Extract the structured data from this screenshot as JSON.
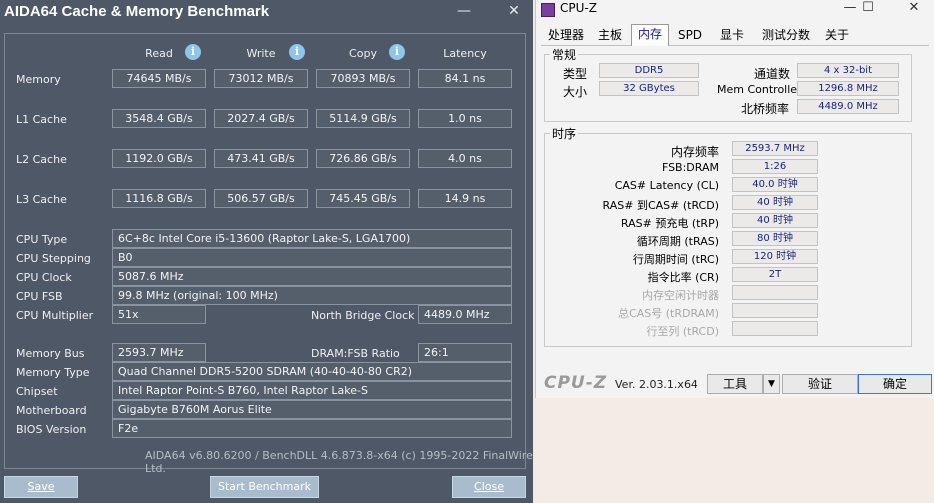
{
  "aida": {
    "title": "AIDA64 Cache & Memory Benchmark",
    "minimize_glyph": "—",
    "close_glyph": "✕",
    "info_glyph": "i",
    "columns": [
      "Read",
      "Write",
      "Copy",
      "Latency"
    ],
    "bench_rows": [
      {
        "label": "Memory",
        "values": [
          "74645 MB/s",
          "73012 MB/s",
          "70893 MB/s",
          "84.1 ns"
        ]
      },
      {
        "label": "L1 Cache",
        "values": [
          "3548.4 GB/s",
          "2027.4 GB/s",
          "5114.9 GB/s",
          "1.0 ns"
        ]
      },
      {
        "label": "L2 Cache",
        "values": [
          "1192.0 GB/s",
          "473.41 GB/s",
          "726.86 GB/s",
          "4.0 ns"
        ]
      },
      {
        "label": "L3 Cache",
        "values": [
          "1116.8 GB/s",
          "506.57 GB/s",
          "745.45 GB/s",
          "14.9 ns"
        ]
      }
    ],
    "cpu_type_label": "CPU Type",
    "cpu_type": "6C+8c Intel Core i5-13600  (Raptor Lake-S, LGA1700)",
    "cpu_stepping_label": "CPU Stepping",
    "cpu_stepping": "B0",
    "cpu_clock_label": "CPU Clock",
    "cpu_clock": "5087.6 MHz",
    "cpu_fsb_label": "CPU FSB",
    "cpu_fsb": "99.8 MHz  (original: 100 MHz)",
    "cpu_mult_label": "CPU Multiplier",
    "cpu_mult": "51x",
    "nb_clock_label": "North Bridge Clock",
    "nb_clock": "4489.0 MHz",
    "mem_bus_label": "Memory Bus",
    "mem_bus": "2593.7 MHz",
    "dram_ratio_label": "DRAM:FSB Ratio",
    "dram_ratio": "26:1",
    "mem_type_label": "Memory Type",
    "mem_type": "Quad Channel DDR5-5200 SDRAM  (40-40-40-80 CR2)",
    "chipset_label": "Chipset",
    "chipset": "Intel Raptor Point-S B760, Intel Raptor Lake-S",
    "mobo_label": "Motherboard",
    "mobo": "Gigabyte B760M Aorus Elite",
    "bios_label": "BIOS Version",
    "bios": "F2e",
    "footer": "AIDA64 v6.80.6200 / BenchDLL 4.6.873.8-x64  (c) 1995-2022 FinalWire Ltd.",
    "save": "Save",
    "start": "Start Benchmark",
    "close": "Close"
  },
  "cpuz": {
    "title": "CPU-Z",
    "min_glyph": "—",
    "max_glyph": "☐",
    "close_glyph": "✕",
    "tabs": [
      "处理器",
      "主板",
      "内存",
      "SPD",
      "显卡",
      "测试分数",
      "关于"
    ],
    "general_title": "常规",
    "type_label": "类型",
    "type": "DDR5",
    "size_label": "大小",
    "size": "32 GBytes",
    "channels_label": "通道数",
    "channels": "4 x 32-bit",
    "memctrl_label": "Mem Controller",
    "memctrl": "1296.8 MHz",
    "nb_label": "北桥频率",
    "nb": "4489.0 MHz",
    "timing_title": "时序",
    "timings": [
      {
        "label": "内存频率",
        "value": "2593.7 MHz"
      },
      {
        "label": "FSB:DRAM",
        "value": "1:26"
      },
      {
        "label": "CAS# Latency (CL)",
        "value": "40.0 时钟"
      },
      {
        "label": "RAS# 到CAS# (tRCD)",
        "value": "40 时钟"
      },
      {
        "label": "RAS# 预充电 (tRP)",
        "value": "40 时钟"
      },
      {
        "label": "循环周期 (tRAS)",
        "value": "80 时钟"
      },
      {
        "label": "行周期时间 (tRC)",
        "value": "120 时钟"
      },
      {
        "label": "指令比率 (CR)",
        "value": "2T"
      },
      {
        "label": "内存空闲计时器",
        "value": ""
      },
      {
        "label": "总CAS号 (tRDRAM)",
        "value": ""
      },
      {
        "label": "行至列 (tRCD)",
        "value": ""
      }
    ],
    "brand": "CPU-Z",
    "version": "Ver. 2.03.1.x64",
    "tools": "工具",
    "dropdown_glyph": "▼",
    "validate": "验证",
    "ok": "确定"
  }
}
